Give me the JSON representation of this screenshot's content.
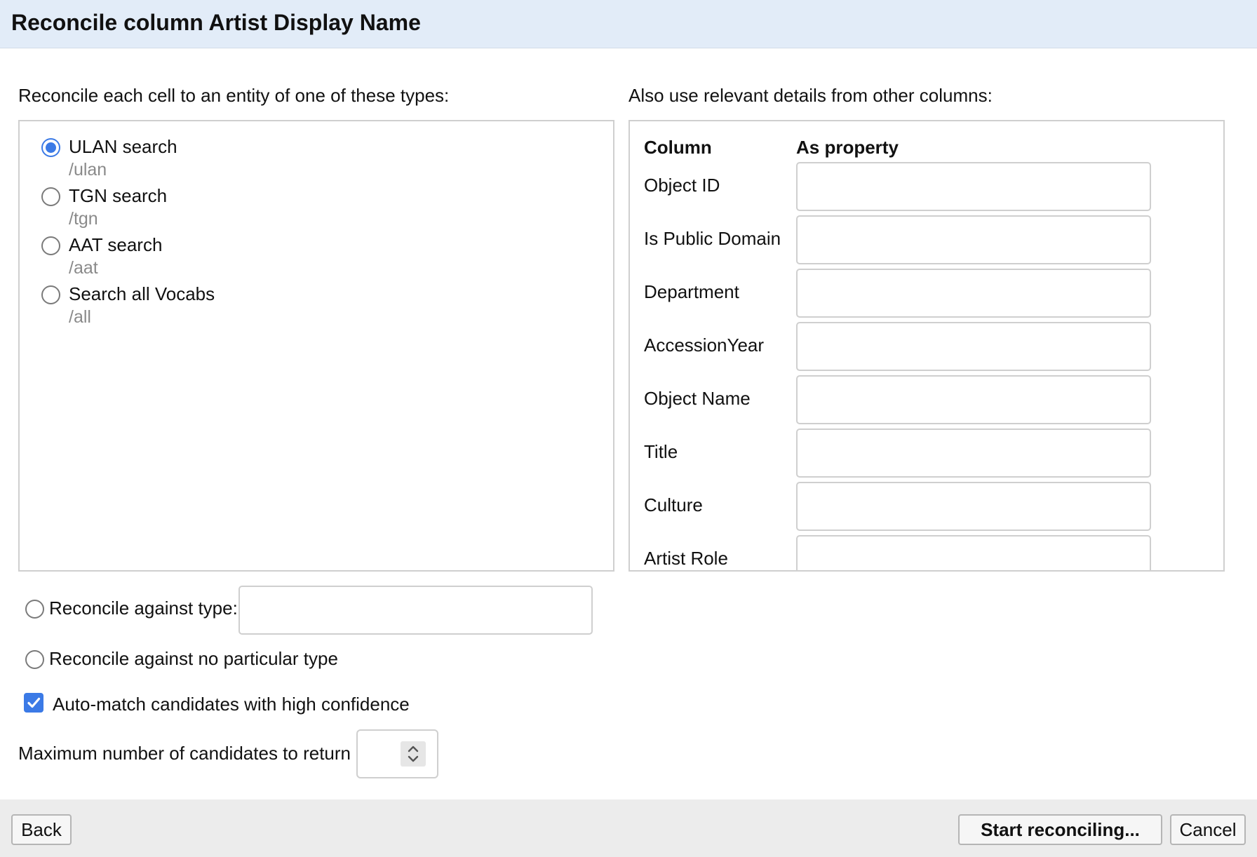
{
  "dialog": {
    "title": "Reconcile column Artist Display Name"
  },
  "types_section": {
    "label": "Reconcile each cell to an entity of one of these types:",
    "selected_index": 0,
    "types": [
      {
        "name": "ULAN search",
        "path": "/ulan"
      },
      {
        "name": "TGN search",
        "path": "/tgn"
      },
      {
        "name": "AAT search",
        "path": "/aat"
      },
      {
        "name": "Search all Vocabs",
        "path": "/all"
      }
    ]
  },
  "details_section": {
    "label": "Also use relevant details from other columns:",
    "column_header": "Column",
    "property_header": "As property",
    "columns": [
      "Object ID",
      "Is Public Domain",
      "Department",
      "AccessionYear",
      "Object Name",
      "Title",
      "Culture",
      "Artist Role"
    ]
  },
  "options": {
    "against_type_label": "Reconcile against type:",
    "against_type_value": "",
    "no_type_label": "Reconcile against no particular type",
    "auto_match_label": "Auto-match candidates with high confidence",
    "auto_match_checked": true,
    "max_candidates_label": "Maximum number of candidates to return",
    "max_candidates_value": ""
  },
  "footer": {
    "back_label": "Back",
    "start_label": "Start reconciling...",
    "cancel_label": "Cancel"
  },
  "colors": {
    "accent": "#3b7ae6",
    "header_bg": "#e2ecf8",
    "footer_bg": "#ececec"
  }
}
